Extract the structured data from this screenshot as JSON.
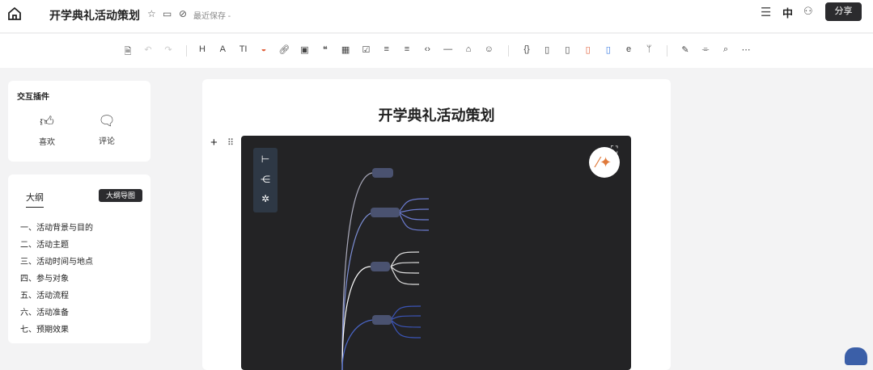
{
  "header": {
    "title": "开学典礼活动策划",
    "saved_status": "最近保存 -",
    "share_label": "分享"
  },
  "toolbar": {
    "groups": [
      [
        "save-icon",
        "undo-icon",
        "redo-icon"
      ],
      [
        "heading-icon",
        "text-style-icon",
        "font-size-icon",
        "highlight-icon",
        "link-icon",
        "image-icon",
        "quote-icon",
        "table-icon",
        "checklist-icon",
        "ordered-list-icon",
        "unordered-list-icon",
        "code-icon",
        "divider-icon",
        "attachment-icon",
        "emoji-icon"
      ],
      [
        "code-block-icon",
        "document-icon",
        "file-icon",
        "pdf-icon",
        "word-icon",
        "formula-icon",
        "branch-icon"
      ],
      [
        "format-painter-icon",
        "clear-format-icon",
        "search-icon",
        "more-icon"
      ]
    ]
  },
  "plugins": {
    "title": "交互插件",
    "like_label": "喜欢",
    "comment_label": "评论"
  },
  "outline": {
    "tab_label": "大纲",
    "map_button_label": "大纲导图",
    "items": [
      "一、活动背景与目的",
      "二、活动主题",
      "三、活动时间与地点",
      "四、参与对象",
      "五、活动流程",
      "六、活动准备",
      "七、预期效果"
    ]
  },
  "document": {
    "title": "开学典礼活动策划"
  }
}
